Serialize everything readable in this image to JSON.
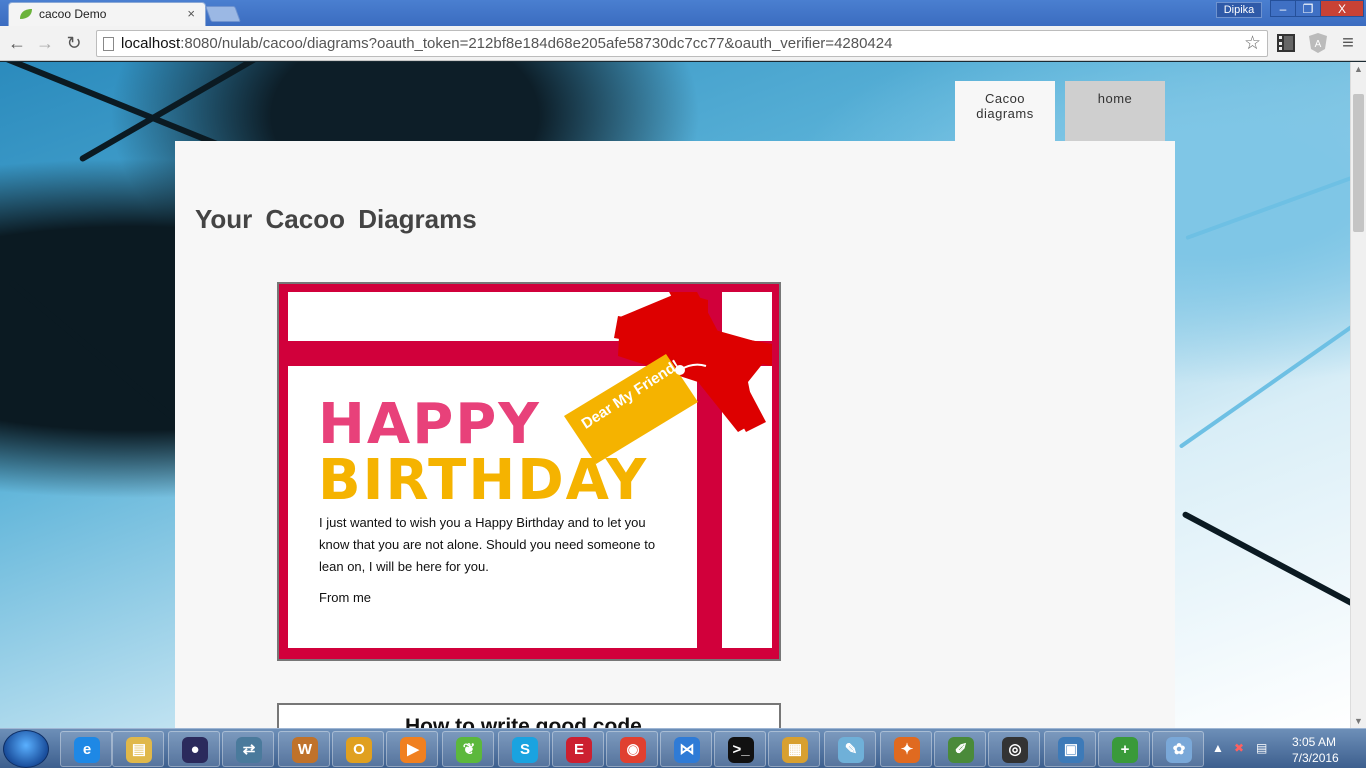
{
  "browser": {
    "tab_title": "cacoo Demo",
    "tab_close": "×",
    "user": "Dipika",
    "window_controls": {
      "minimize": "–",
      "restore": "❐",
      "close": "X"
    },
    "url_host": "localhost",
    "url_rest": ":8080/nulab/cacoo/diagrams?oauth_token=212bf8e184d68e205afe58730dc7cc77&oauth_verifier=4280424"
  },
  "nav": {
    "cacoo_diagrams": "Cacoo diagrams",
    "home": "home"
  },
  "page": {
    "title": "Your Cacoo Diagrams"
  },
  "card1": {
    "line1": "HAPPY",
    "line2": "BIRTHDAY",
    "tag": "Dear My Friend!",
    "message": "I just wanted to wish you a Happy Birthday and to let you know that you are not alone. Should you need someone to lean on, I will be here for you.",
    "from": "From me"
  },
  "card2": {
    "title": "How to write good code"
  },
  "taskbar": {
    "time": "3:05 AM",
    "date": "7/3/2016",
    "apps": [
      "internet-explorer",
      "file-explorer",
      "eclipse",
      "file-transfer",
      "word",
      "outlook",
      "media-player",
      "spring-tool-suite",
      "skype",
      "evernote",
      "chrome",
      "visual-studio",
      "command-prompt",
      "archive-manager",
      "notepad",
      "postman",
      "notepad-plus-plus",
      "disc-burner",
      "image-viewer",
      "greenshot",
      "paint"
    ]
  },
  "colors": {
    "card_red": "#d1003b",
    "happy_pink": "#e8417a",
    "birthday_yellow": "#f5b300",
    "bow_red": "#dd0000"
  }
}
